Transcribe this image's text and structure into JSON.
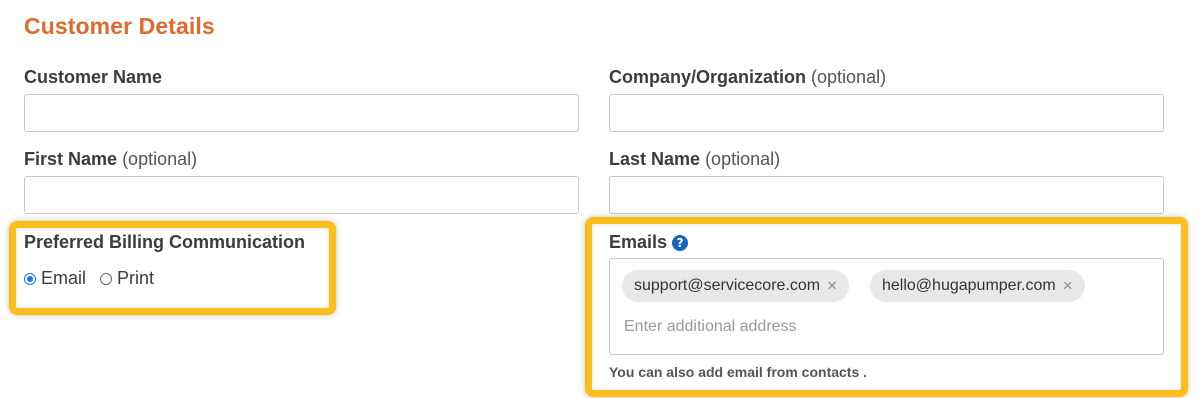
{
  "section": {
    "title": "Customer Details"
  },
  "fields": {
    "customer_name": {
      "label": "Customer Name",
      "value": ""
    },
    "company": {
      "label": "Company/Organization",
      "optional": "(optional)",
      "value": ""
    },
    "first_name": {
      "label": "First Name",
      "optional": "(optional)",
      "value": ""
    },
    "last_name": {
      "label": "Last Name",
      "optional": "(optional)",
      "value": ""
    }
  },
  "billing": {
    "label": "Preferred Billing Communication",
    "options": [
      {
        "label": "Email",
        "selected": true
      },
      {
        "label": "Print",
        "selected": false
      }
    ]
  },
  "emails": {
    "label": "Emails",
    "help_icon": "?",
    "chips": [
      {
        "email": "support@servicecore.com",
        "remove": "×"
      },
      {
        "email": "hello@hugapumper.com",
        "remove": "×"
      }
    ],
    "placeholder": "Enter additional address",
    "hint": "You can also add email from contacts ."
  },
  "colors": {
    "title": "#e0692e",
    "highlight": "#fbbf1c",
    "radio_accent": "#1a73e8",
    "help_icon": "#1565c0",
    "chip_bg": "#e8e8e8"
  }
}
